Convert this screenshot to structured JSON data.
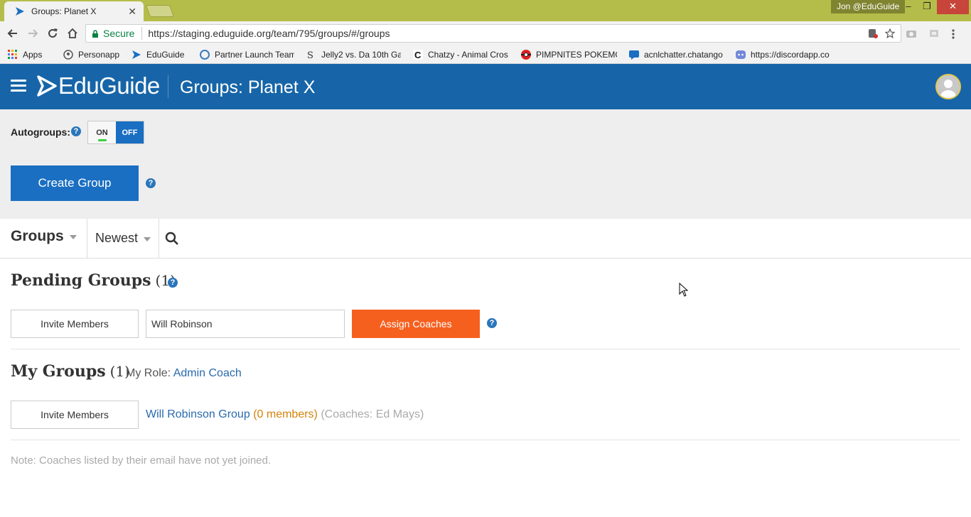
{
  "browser": {
    "tab_title": "Groups: Planet X",
    "tab_close": "✕",
    "profile_name": "Jon @EduGuide",
    "window_controls": {
      "minimize": "–",
      "restore": "❐",
      "close": "✕"
    },
    "omnibox": {
      "secure_label": "Secure",
      "url": "https://staging.eduguide.org/team/795/groups/#/groups"
    },
    "bookmarks": [
      {
        "label": "Apps",
        "icon": "apps-grid-icon"
      },
      {
        "label": "Personapp",
        "icon": "personapp-icon"
      },
      {
        "label": "EduGuide",
        "icon": "eduguide-icon"
      },
      {
        "label": "Partner Launch Team",
        "icon": "partner-icon"
      },
      {
        "label": "Jelly2 vs. Da 10th Gar",
        "icon": "jelly-icon"
      },
      {
        "label": "Chatzy - Animal Cros",
        "icon": "chatzy-icon"
      },
      {
        "label": "PIMPNITES POKEMO",
        "icon": "pokeball-icon"
      },
      {
        "label": "acnlchatter.chatango",
        "icon": "chatango-icon"
      },
      {
        "label": "https://discordapp.co",
        "icon": "discord-icon"
      }
    ]
  },
  "header": {
    "logo_text": "EduGuide",
    "page_title": "Groups: Planet X"
  },
  "autogroups": {
    "label": "Autogroups:",
    "help": "?",
    "toggle_on": "ON",
    "toggle_off": "OFF",
    "state": "off"
  },
  "actions": {
    "create_group": "Create Group",
    "help": "?"
  },
  "filterbar": {
    "groups_label": "Groups",
    "sort_label": "Newest"
  },
  "pending": {
    "title": "Pending Groups",
    "count": "(1)",
    "help": "?",
    "invite_label": "Invite Members",
    "name_value": "Will Robinson",
    "assign_label": "Assign Coaches",
    "assign_help": "?"
  },
  "my_groups": {
    "title": "My Groups",
    "count": "(1)",
    "role_label": "My Role:",
    "role_value": "Admin Coach",
    "invite_label": "Invite Members",
    "group_name": "Will Robinson Group",
    "group_members": "(0 members)",
    "group_coaches": "(Coaches: Ed Mays)"
  },
  "note": "Note: Coaches listed by their email have not yet joined.",
  "colors": {
    "brand_blue": "#1765a8",
    "button_blue": "#1a6fc2",
    "assign_orange": "#f6601f",
    "link_blue": "#2a6aad",
    "members_orange": "#d4820a",
    "chrome_frame": "#b5bd4a"
  }
}
